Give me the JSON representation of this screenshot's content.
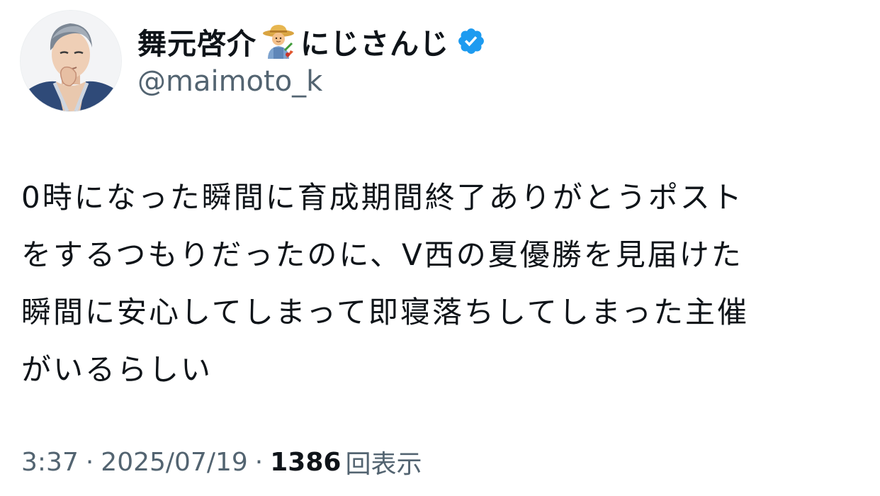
{
  "author": {
    "display_name": "舞元啓介",
    "display_name_suffix": "にじさんじ",
    "name_emoji": "farmer-icon",
    "verified_badge": "verified-icon",
    "handle": "@maimoto_k",
    "avatar": "avatar"
  },
  "tweet": {
    "text": "0時になった瞬間に育成期間終了ありがとうポスト\nをするつもりだったのに、V西の夏優勝を見届けた\n瞬間に安心してしまって即寝落ちしてしまった主催\nがいるらしい"
  },
  "meta": {
    "time": "3:37",
    "separator": "·",
    "date": "2025/07/19",
    "views_count": "1386",
    "views_label": "回表示"
  },
  "colors": {
    "text": "#0f1419",
    "secondary": "#536471",
    "verified": "#1d9bf0"
  }
}
